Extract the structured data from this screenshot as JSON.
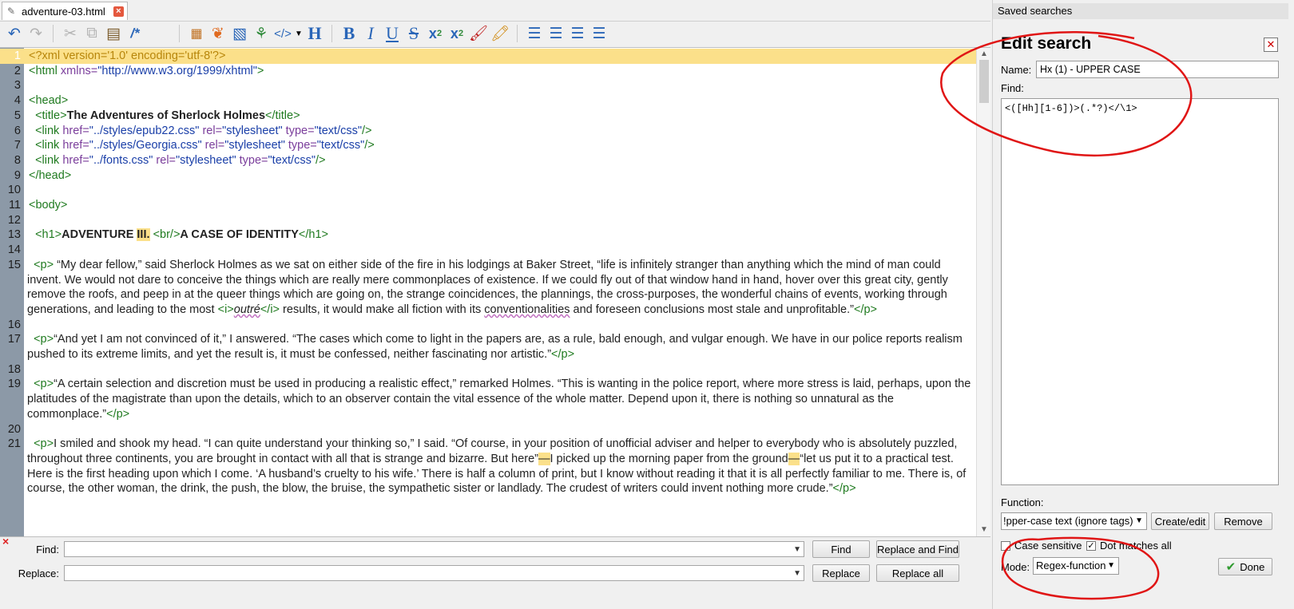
{
  "tab": {
    "title": "adventure-03.html"
  },
  "toolbar": {
    "icons": [
      "undo-icon",
      "redo-icon",
      "cut-icon",
      "copy-icon",
      "paste-icon",
      "comment-icon",
      "insert-html-icon",
      "insert-image-icon",
      "insert-link-icon",
      "insert-symbol-icon",
      "insert-tag-icon",
      "heading-icon",
      "bold-icon",
      "italic-icon",
      "underline-icon",
      "strikethrough-icon",
      "subscript-icon",
      "superscript-icon",
      "text-color-icon",
      "background-color-icon",
      "align-left-icon",
      "align-center-icon",
      "align-right-icon",
      "justify-icon"
    ]
  },
  "editor": {
    "current_line": 1,
    "lines": [
      {
        "n": "1"
      },
      {
        "n": "2"
      },
      {
        "n": "3"
      },
      {
        "n": "4"
      },
      {
        "n": "5"
      },
      {
        "n": "6"
      },
      {
        "n": "7"
      },
      {
        "n": "8"
      },
      {
        "n": "9"
      },
      {
        "n": "10"
      },
      {
        "n": "11"
      },
      {
        "n": "12"
      },
      {
        "n": "13"
      },
      {
        "n": "14"
      },
      {
        "n": "15"
      },
      {
        "n": "16"
      },
      {
        "n": "17"
      },
      {
        "n": "18"
      },
      {
        "n": "19"
      },
      {
        "n": "20"
      },
      {
        "n": "21"
      }
    ],
    "text": {
      "l1": "<?xml version='1.0' encoding='utf-8'?>",
      "l2_tag": "<html ",
      "l2_attr": "xmlns=",
      "l2_val": "\"http://www.w3.org/1999/xhtml\"",
      "l2_end": ">",
      "l4": "<head>",
      "l5_open": "<title>",
      "l5_text": "The Adventures of Sherlock Holmes",
      "l5_close": "</title>",
      "l6_val": "\"../styles/epub22.css\"",
      "l7_val": "\"../styles/Georgia.css\"",
      "l8_val": "\"../fonts.css\"",
      "link_open": "<link ",
      "href": "href=",
      "rel": " rel=",
      "rel_val": "\"stylesheet\"",
      "type": " type=",
      "type_val": "\"text/css\"",
      "self_close": "/>",
      "l9": "</head>",
      "l11": "<body>",
      "l13_open": "<h1>",
      "l13_a": "ADVENTURE ",
      "l13_b": "III.",
      "l13_br": "<br/>",
      "l13_c": "A CASE OF IDENTITY",
      "l13_close": "</h1>",
      "p_open": "<p>",
      "p_close": "</p>",
      "l15_a": " “My dear fellow,” said Sherlock Holmes as we sat on either side of the fire in his lodgings at Baker Street, “life is infinitely stranger than anything which the mind of man could invent. We would not dare to conceive the things which are really mere commonplaces of existence. If we could fly out of that window hand in hand, hover over this great city, gently remove the roofs, and peep in at the queer things which are going on, the strange coincidences, the plannings, the cross-purposes, the wonderful chains of events, working through generations, and leading to the most ",
      "i_open": "<i>",
      "l15_i": "outré",
      "i_close": "</i>",
      "l15_b": " results, it would make all fiction with its ",
      "l15_ul": "conventionalities",
      "l15_c": " and foreseen conclusions most stale and unprofitable.”",
      "l17": "“And yet I am not convinced of it,” I answered. “The cases which come to light in the papers are, as a rule, bald enough, and vulgar enough. We have in our police reports realism pushed to its extreme limits, and yet the result is, it must be confessed, neither fascinating nor artistic.”",
      "l19": "“A certain selection and discretion must be used in producing a realistic effect,” remarked Holmes. “This is wanting in the police report, where more stress is laid, perhaps, upon the platitudes of the magistrate than upon the details, which to an observer contain the vital essence of the whole matter. Depend upon it, there is nothing so unnatural as the commonplace.”",
      "l21_a": "I smiled and shook my head. “I can quite understand your thinking so,” I said. “Of course, in your position of unofficial adviser and helper to everybody who is absolutely puzzled, throughout three continents, you are brought in contact with all that is strange and bizarre. But here”",
      "dash": "—",
      "l21_b": "I picked up the morning paper from the ground",
      "l21_c": "“let us put it to a practical test. Here is the first heading upon which I come. ‘A husband’s cruelty to his wife.’ There is half a column of print, but I know without reading it that it is all perfectly familiar to me. There is, of course, the other woman, the drink, the push, the blow, the bruise, the sympathetic sister or landlady. The crudest of writers could invent nothing more crude.”"
    }
  },
  "findbar": {
    "find_label": "Find:",
    "replace_label": "Replace:",
    "find_value": "",
    "replace_value": "",
    "find_btn": "Find",
    "replace_and_find_btn": "Replace and Find",
    "replace_btn": "Replace",
    "replace_all_btn": "Replace all"
  },
  "saved_searches": {
    "panel_title": "Saved searches",
    "edit_title": "Edit search",
    "name_label": "Name:",
    "name_value": "Hx (1) - UPPER CASE",
    "find_label": "Find:",
    "find_value": "<([Hh][1-6])>(.*?)</\\1>",
    "function_label": "Function:",
    "function_value": "!pper-case text (ignore tags)",
    "create_edit_btn": "Create/edit",
    "remove_btn": "Remove",
    "case_sensitive_label": "Case sensitive",
    "case_sensitive": false,
    "dot_matches_all_label": "Dot matches all",
    "dot_matches_all": true,
    "mode_label": "Mode:",
    "mode_value": "Regex-function",
    "done_btn": "Done"
  },
  "colors": {
    "annotation": "#e01515",
    "current_line": "#fbe08a",
    "gutter": "#8c99a7"
  }
}
